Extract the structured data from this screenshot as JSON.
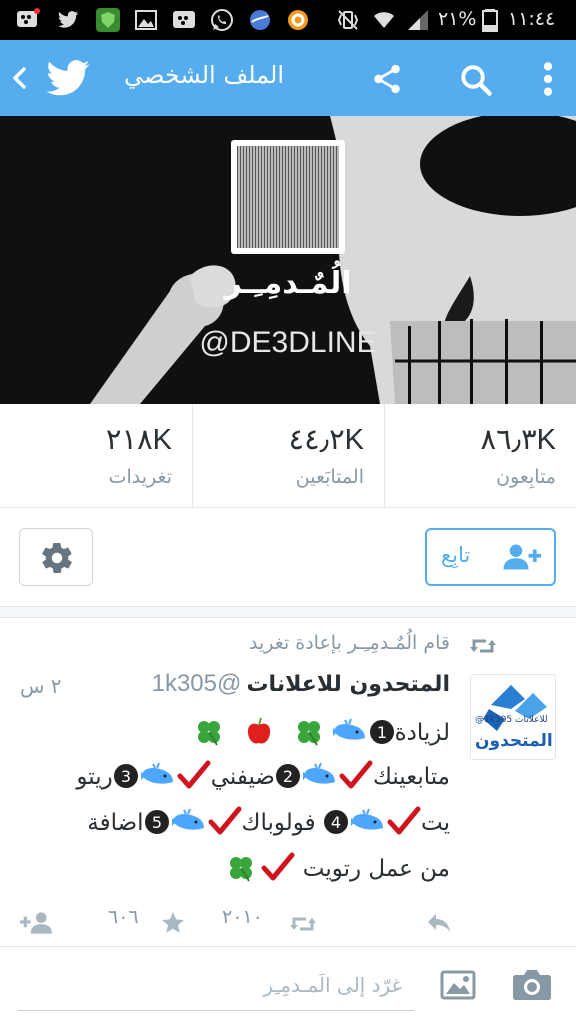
{
  "status_bar": {
    "battery_percent": "٢١%",
    "time": "١١:٤٤",
    "icons": [
      "bbm-icon",
      "twitter-icon",
      "shield-app-icon",
      "image-icon",
      "bbm-icon",
      "whatsapp-icon",
      "browser-icon",
      "orange-app-icon",
      "vibrate-icon",
      "wifi-icon",
      "signal-icon",
      "battery-icon"
    ]
  },
  "app_bar": {
    "title": "الملف الشخصي",
    "icons": [
      "back-chevron-icon",
      "twitter-bird-icon",
      "share-icon",
      "search-icon",
      "overflow-menu-icon"
    ]
  },
  "profile": {
    "display_name": "الُمٌـدمِـِـر",
    "handle": "@DE3DLINE"
  },
  "stats": [
    {
      "value": "٢١٨K",
      "label": "تغريدات"
    },
    {
      "value": "٤٤٫٢K",
      "label": "المتابَعين"
    },
    {
      "value": "٨٦٫٣K",
      "label": "متابِعون"
    }
  ],
  "follow_button": {
    "label": "تابِع"
  },
  "tweet": {
    "retweet_context": "قام الُمٌـدمِـِـر بإعادة تغريد",
    "author_name": "المتحدون للاعلانات",
    "author_handle": "@1k305",
    "time": "٢ س",
    "avatar_text": "المتحدون",
    "avatar_small": "@1k305 للاعلانات",
    "lines": [
      "لزيادة",
      "متابعينك",
      "ضيفني",
      "ريتو",
      "يت",
      "فولوباك",
      "اضافة",
      "من عمل رتويت"
    ],
    "numbers": [
      "1",
      "2",
      "3",
      "4",
      "5"
    ],
    "retweet_count": "٢٠١٠",
    "favorite_count": "٦٠٦"
  },
  "compose": {
    "placeholder": "غرّد إلى الَمـدمِـِر"
  },
  "colors": {
    "accent": "#55acee",
    "text": "#292f33",
    "muted": "#8899a6",
    "check": "#d0141d"
  }
}
